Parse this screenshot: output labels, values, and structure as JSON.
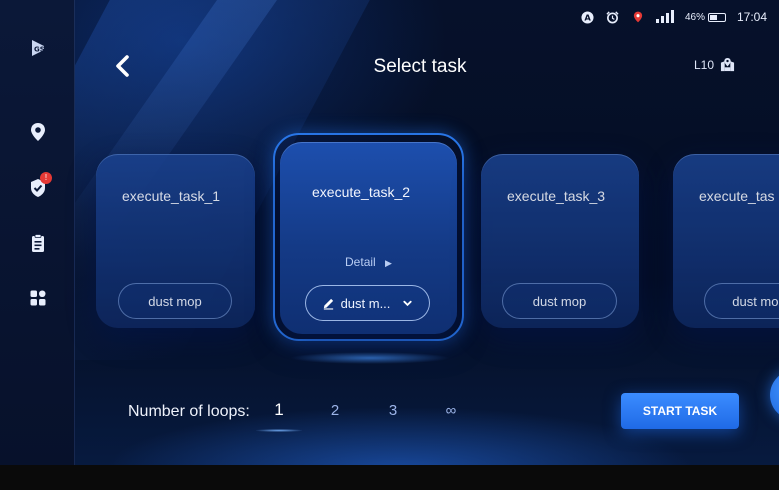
{
  "status_bar": {
    "battery_percent": "46%",
    "battery_level": 0.46,
    "time": "17:04",
    "icons": [
      "a-circle-icon",
      "alarm-icon",
      "location-pin-icon",
      "signal-icon",
      "battery-icon"
    ]
  },
  "sidebar": {
    "logo": "gs-logo-icon",
    "items": [
      {
        "name": "map-pin",
        "icon": "location-icon"
      },
      {
        "name": "tasks",
        "icon": "shield-check-icon",
        "badge": "!"
      },
      {
        "name": "reports",
        "icon": "clipboard-icon"
      },
      {
        "name": "apps",
        "icon": "grid-icon"
      }
    ]
  },
  "header": {
    "back_icon": "chevron-left-icon",
    "title": "Select task",
    "robot_label": "L10",
    "robot_icon": "map-location-icon"
  },
  "cards": [
    {
      "name": "execute_task_1",
      "mode": "dust mop"
    },
    {
      "name": "execute_task_2",
      "mode": "dust m...",
      "detail": "Detail",
      "selected": true
    },
    {
      "name": "execute_task_3",
      "mode": "dust mop"
    },
    {
      "name": "execute_tas",
      "mode": "dust mop"
    }
  ],
  "loops": {
    "label": "Number of loops:",
    "options": [
      "1",
      "2",
      "3",
      "∞"
    ],
    "selected": "1"
  },
  "actions": {
    "start_task_label": "START TASK"
  },
  "colors": {
    "accent": "#2b7cf0",
    "card": "#1d4fae",
    "background": "#06112b",
    "badge": "#e53935"
  }
}
